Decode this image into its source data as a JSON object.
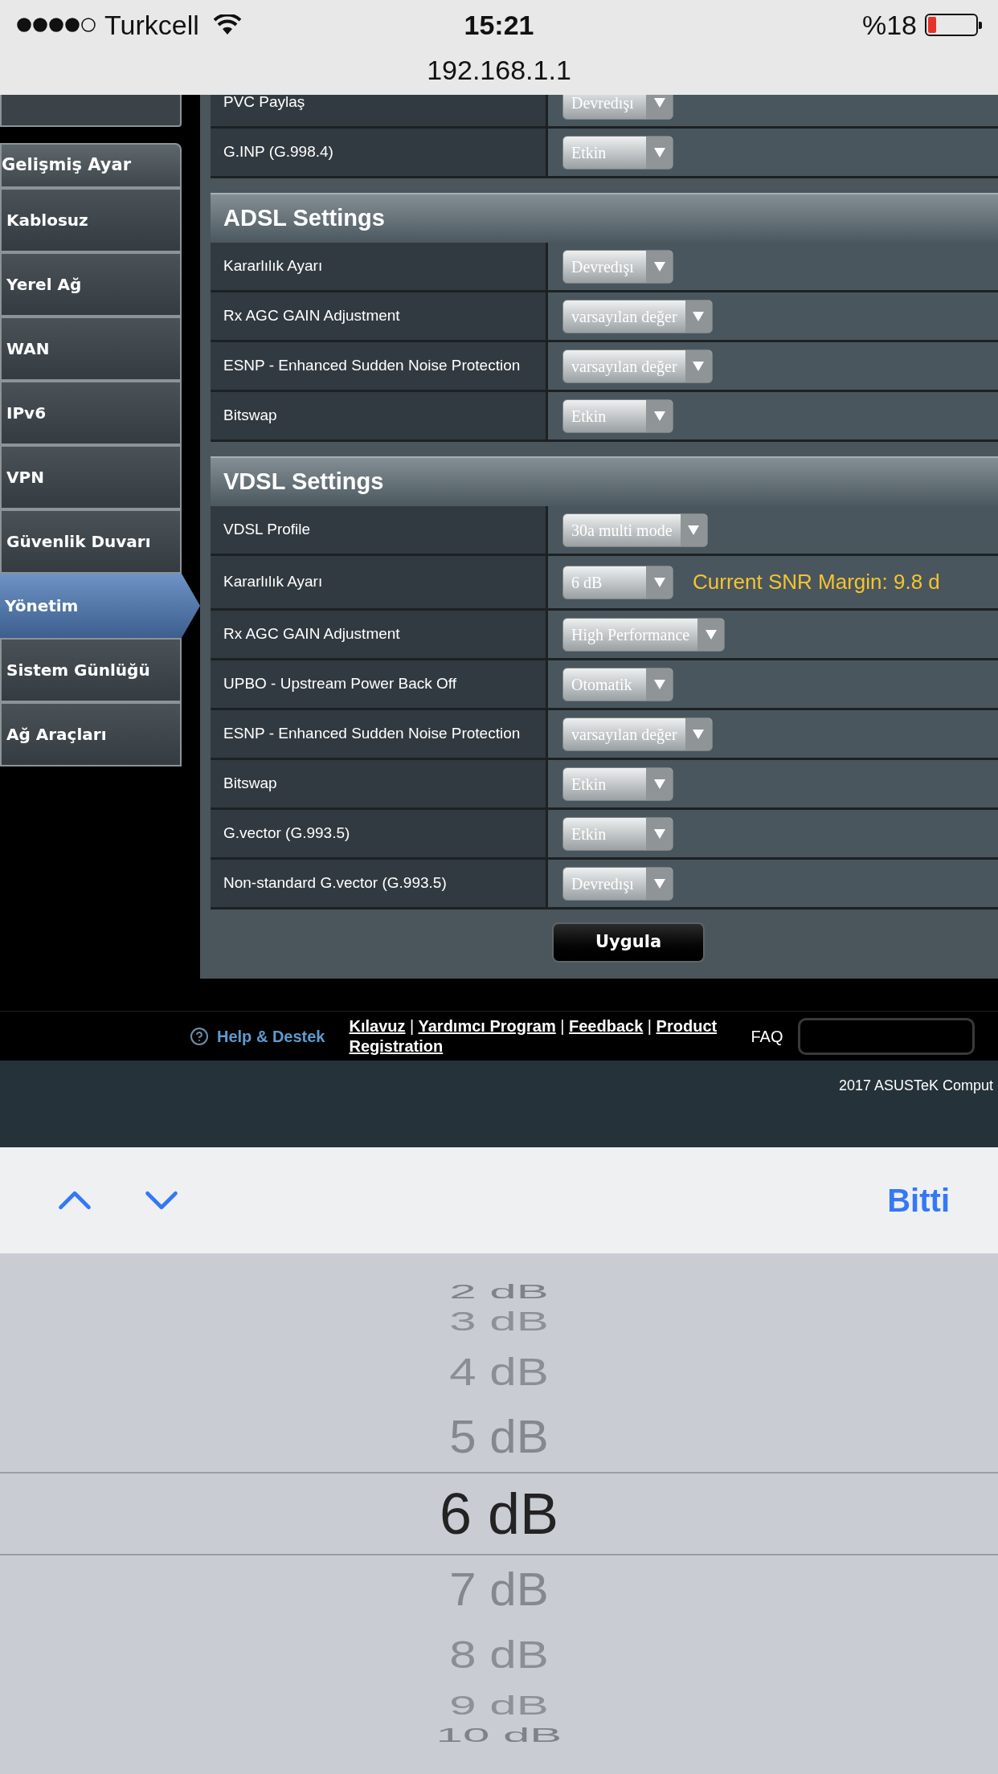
{
  "status_bar": {
    "carrier": "Turkcell",
    "time": "15:21",
    "battery": "%18",
    "url": "192.168.1.1"
  },
  "sidebar": {
    "header": "Gelişmiş Ayar",
    "items": [
      {
        "label": "Kablosuz",
        "selected": false
      },
      {
        "label": "Yerel Ağ",
        "selected": false
      },
      {
        "label": "WAN",
        "selected": false
      },
      {
        "label": "IPv6",
        "selected": false
      },
      {
        "label": "VPN",
        "selected": false
      },
      {
        "label": "Güvenlik Duvarı",
        "selected": false
      },
      {
        "label": "Yönetim",
        "selected": true
      },
      {
        "label": "Sistem Günlüğü",
        "selected": false
      },
      {
        "label": "Ağ Araçları",
        "selected": false
      }
    ]
  },
  "sections": [
    {
      "rows": [
        {
          "label": "PVC Paylaş",
          "value": "Devredışı"
        },
        {
          "label": "G.INP (G.998.4)",
          "value": "Etkin"
        }
      ]
    },
    {
      "title": "ADSL Settings",
      "rows": [
        {
          "label": "Kararlılık Ayarı",
          "value": "Devredışı"
        },
        {
          "label": "Rx AGC GAIN Adjustment",
          "value": "varsayılan değer"
        },
        {
          "label": "ESNP - Enhanced Sudden Noise Protection",
          "value": "varsayılan değer"
        },
        {
          "label": "Bitswap",
          "value": "Etkin"
        }
      ]
    },
    {
      "title": "VDSL Settings",
      "rows": [
        {
          "label": "VDSL Profile",
          "value": "30a multi mode"
        },
        {
          "label": "Kararlılık Ayarı",
          "value": "6 dB",
          "note": "Current SNR Margin: 9.8 d"
        },
        {
          "label": "Rx AGC GAIN Adjustment",
          "value": "High Performance"
        },
        {
          "label": "UPBO - Upstream Power Back Off",
          "value": "Otomatik"
        },
        {
          "label": "ESNP - Enhanced Sudden Noise Protection",
          "value": "varsayılan değer"
        },
        {
          "label": "Bitswap",
          "value": "Etkin"
        },
        {
          "label": "G.vector (G.993.5)",
          "value": "Etkin"
        },
        {
          "label": "Non-standard G.vector (G.993.5)",
          "value": "Devredışı"
        }
      ]
    }
  ],
  "apply_button": "Uygula",
  "footer": {
    "help": "Help & Destek",
    "links": [
      {
        "kind": "link",
        "text": "Kılavuz"
      },
      {
        "kind": "separator",
        "text": "|"
      },
      {
        "kind": "link",
        "text": "Yardımcı Program"
      },
      {
        "kind": "separator",
        "text": "|"
      },
      {
        "kind": "link",
        "text": "Feedback"
      },
      {
        "kind": "separator",
        "text": "|"
      },
      {
        "kind": "link",
        "text": "Product"
      },
      {
        "kind": "link",
        "text": "Registration"
      }
    ],
    "faq": "FAQ",
    "copyright": "2017 ASUSTeK Comput"
  },
  "keyboard_toolbar": {
    "done": "Bitti"
  },
  "picker": {
    "options": [
      {
        "label": "2 dB",
        "selected": false
      },
      {
        "label": "3 dB",
        "selected": false
      },
      {
        "label": "4 dB",
        "selected": false
      },
      {
        "label": "5 dB",
        "selected": false
      },
      {
        "label": "6 dB",
        "selected": true
      },
      {
        "label": "7 dB",
        "selected": false
      },
      {
        "label": "8 dB",
        "selected": false
      },
      {
        "label": "9 dB",
        "selected": false
      },
      {
        "label": "10 dB",
        "selected": false
      }
    ]
  }
}
